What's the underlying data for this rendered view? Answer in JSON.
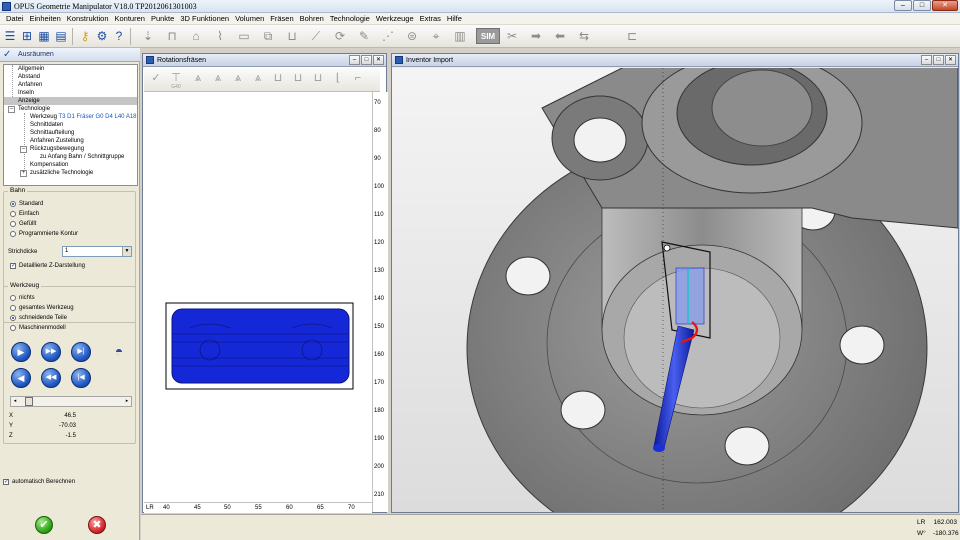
{
  "window": {
    "title": "OPUS Geometrie Manipulator V18.0   TP2012061301003",
    "controls": {
      "minimize": "–",
      "maximize": "□",
      "close": "✕"
    }
  },
  "menu": [
    "Datei",
    "Einheiten",
    "Konstruktion",
    "Konturen",
    "Punkte",
    "3D Funktionen",
    "Volumen",
    "Fräsen",
    "Bohren",
    "Technologie",
    "Werkzeuge",
    "Extras",
    "Hilfe"
  ],
  "left_panel": {
    "header": "Ausräumen",
    "tree": {
      "allgemein": "Allgemein",
      "abstand": "Abstand",
      "anfahren": "Anfahren",
      "inseln": "Inseln",
      "anzeige": "Anzeige",
      "technologie": "Technologie",
      "werkzeug_label": "Werkzeug",
      "werkzeug_value": "T3 D1 Fräser G0 D4 L40 A18",
      "schnittdaten": "Schnittdaten",
      "schnittaufteilung": "Schnittaufteilung",
      "anfahren_zustellung": "Anfahren Zustellung",
      "rueckzugsbewegung": "Rückzugsbewegung",
      "zu_anfang": "zu Anfang Bahn / Schnittgruppe",
      "kompensation": "Kompensation",
      "zusaetzliche": "zusätzliche Technologie"
    },
    "bahn": {
      "title": "Bahn",
      "options": [
        "Standard",
        "Einfach",
        "Gefüllt",
        "Programmierte Kontur"
      ],
      "selected": 0,
      "strichdicke_label": "Strichdicke",
      "strichdicke_value": "1",
      "detail_z_label": "Detaillierte Z-Darstellung",
      "detail_z_checked": true
    },
    "werkzeug": {
      "title": "Werkzeug",
      "options": [
        "nichts",
        "gesamtes Werkzeug",
        "schneidende Teile",
        "Maschinenmodell"
      ],
      "selected": 2
    },
    "coords": {
      "x_label": "X",
      "x": "46.5",
      "y_label": "Y",
      "y": "-70.03",
      "z_label": "Z",
      "z": "-1.5"
    },
    "auto_calc_label": "automatisch Berechnen",
    "auto_calc_checked": true,
    "playback": {
      "play": "▶",
      "fast_forward": "▶▶",
      "to_end": "▶|",
      "reverse": "◀",
      "fast_reverse": "◀◀",
      "to_start": "|◀"
    },
    "ok": "✔",
    "cancel": "✖"
  },
  "rotations_window": {
    "title": "Rotationsfräsen",
    "toolbar_sub": "G40",
    "ruler_right": [
      "70",
      "80",
      "90",
      "100",
      "110",
      "120",
      "130",
      "140",
      "150",
      "160",
      "170",
      "180",
      "190",
      "200",
      "210"
    ],
    "ruler_bottom_prefix": "LR",
    "ruler_bottom": [
      "40",
      "45",
      "50",
      "55",
      "60",
      "65",
      "70"
    ]
  },
  "inventor_window": {
    "title": "Inventor Import"
  },
  "status": {
    "lr_label": "LR",
    "lr_value": "162.003",
    "w_label": "W°",
    "w_value": "-180.376"
  },
  "colors": {
    "part_fill": "#8c8c8c",
    "tool_blue": "#1c2fd6",
    "toolpath_red": "#e01818",
    "rot_fill": "#1428d8"
  }
}
